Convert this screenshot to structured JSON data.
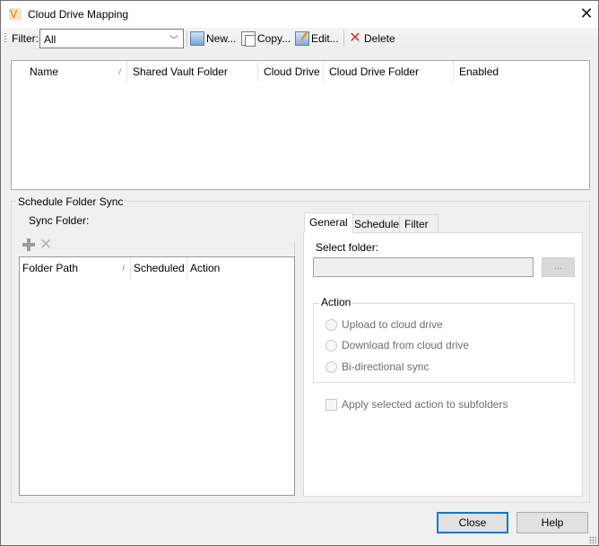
{
  "window": {
    "title": "Cloud Drive Mapping",
    "app_icon": "vault-v-icon",
    "close_glyph": "✕"
  },
  "toolbar": {
    "filter_label": "Filter:",
    "filter_value": "All",
    "filter_arrow": "﹀",
    "new_label": "New...",
    "copy_label": "Copy...",
    "edit_label": "Edit...",
    "delete_label": "Delete",
    "delete_glyph": "✕"
  },
  "mapping_table": {
    "columns": [
      {
        "label": "Name",
        "sort": "/"
      },
      {
        "label": "Shared Vault Folder"
      },
      {
        "label": "Cloud Drive"
      },
      {
        "label": "Cloud Drive Folder"
      },
      {
        "label": "Enabled"
      }
    ],
    "rows": []
  },
  "schedule": {
    "group_title": "Schedule Folder Sync",
    "sync_folder_label": "Sync Folder:",
    "remove_glyph": "✕",
    "folder_table": {
      "columns": [
        {
          "label": "Folder Path",
          "sort": "/"
        },
        {
          "label": "Scheduled"
        },
        {
          "label": "Action"
        }
      ],
      "rows": []
    },
    "tabs": [
      {
        "label": "General",
        "active": true
      },
      {
        "label": "Schedule",
        "active": false
      },
      {
        "label": "Filter",
        "active": false
      }
    ],
    "general": {
      "select_folder_label": "Select folder:",
      "folder_value": "",
      "browse_label": "...",
      "action_group_title": "Action",
      "actions": [
        {
          "label": "Upload to cloud drive",
          "selected": false
        },
        {
          "label": "Download from cloud drive",
          "selected": false
        },
        {
          "label": "Bi-directional sync",
          "selected": false
        }
      ],
      "apply_subfolders_label": "Apply selected action to subfolders",
      "apply_subfolders_checked": false
    }
  },
  "footer": {
    "close_label": "Close",
    "help_label": "Help"
  },
  "colors": {
    "default_button_border": "#0078d7",
    "delete_icon": "#d0342c",
    "app_icon": "#e0a030"
  }
}
